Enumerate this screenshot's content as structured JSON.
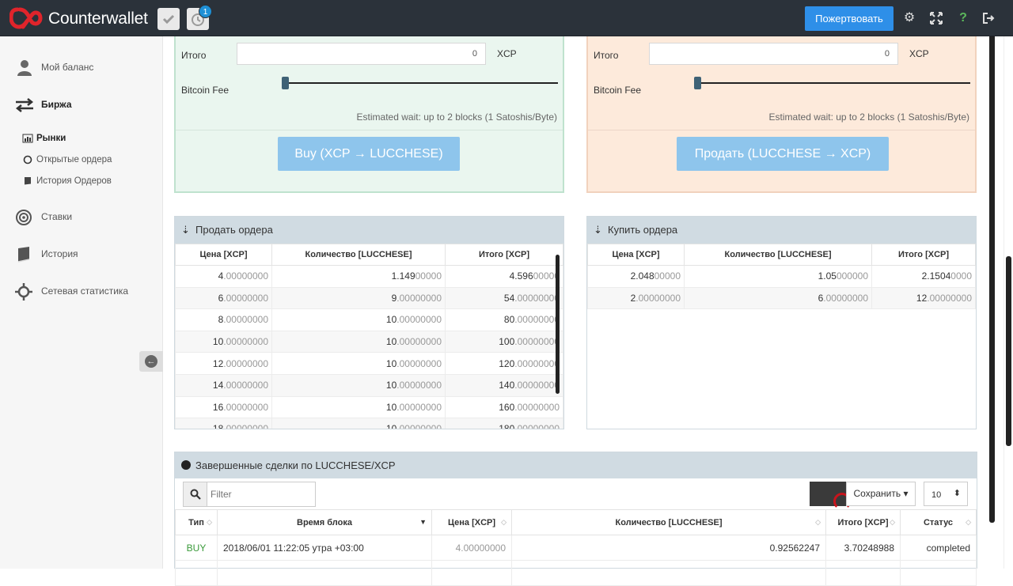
{
  "header": {
    "brand": "Counterwallet",
    "notification_count": "1",
    "donate_label": "Пожертвовать"
  },
  "sidebar": {
    "items": [
      {
        "label": "Мой баланс",
        "icon": "user-icon"
      },
      {
        "label": "Биржа",
        "icon": "exchange-icon"
      },
      {
        "label": "Ставки",
        "icon": "target-icon"
      },
      {
        "label": "История",
        "icon": "book-icon"
      },
      {
        "label": "Сетевая статистика",
        "icon": "crosshair-icon"
      }
    ],
    "subitems": [
      {
        "label": "Рынки",
        "icon": "bar-chart-icon"
      },
      {
        "label": "Открытые ордера",
        "icon": "circle-icon"
      },
      {
        "label": "История Ордеров",
        "icon": "book-icon"
      }
    ]
  },
  "buy_panel": {
    "total_label": "Итого",
    "total_value": "0",
    "unit": "XCP",
    "fee_label": "Bitcoin Fee",
    "estimate": "Estimated wait: up to 2 blocks (1 Satoshis/Byte)",
    "button_label": "Buy (XCP → LUCCHESE)"
  },
  "sell_panel": {
    "total_label": "Итого",
    "total_value": "0",
    "unit": "XCP",
    "fee_label": "Bitcoin Fee",
    "estimate": "Estimated wait: up to 2 blocks (1 Satoshis/Byte)",
    "button_label": "Продать (LUCCHESE → XCP)"
  },
  "sell_orders": {
    "title": "Продать ордера",
    "columns": [
      "Цена [XCP]",
      "Количество [LUCCHESE]",
      "Итого [XCP]"
    ],
    "rows": [
      [
        [
          "4",
          ".00000000"
        ],
        [
          "1.149",
          "00000"
        ],
        [
          "4.596",
          "00000"
        ]
      ],
      [
        [
          "6",
          ".00000000"
        ],
        [
          "9",
          ".00000000"
        ],
        [
          "54",
          ".00000000"
        ]
      ],
      [
        [
          "8",
          ".00000000"
        ],
        [
          "10",
          ".00000000"
        ],
        [
          "80",
          ".00000000"
        ]
      ],
      [
        [
          "10",
          ".00000000"
        ],
        [
          "10",
          ".00000000"
        ],
        [
          "100",
          ".00000000"
        ]
      ],
      [
        [
          "12",
          ".00000000"
        ],
        [
          "10",
          ".00000000"
        ],
        [
          "120",
          ".00000000"
        ]
      ],
      [
        [
          "14",
          ".00000000"
        ],
        [
          "10",
          ".00000000"
        ],
        [
          "140",
          ".00000000"
        ]
      ],
      [
        [
          "16",
          ".00000000"
        ],
        [
          "10",
          ".00000000"
        ],
        [
          "160",
          ".00000000"
        ]
      ],
      [
        [
          "18",
          ".00000000"
        ],
        [
          "10",
          ".00000000"
        ],
        [
          "180",
          ".00000000"
        ]
      ]
    ]
  },
  "buy_orders": {
    "title": "Купить ордера",
    "columns": [
      "Цена [XCP]",
      "Количество [LUCCHESE]",
      "Итого [XCP]"
    ],
    "rows": [
      [
        [
          "2.048",
          "00000"
        ],
        [
          "1.05",
          "000000"
        ],
        [
          "2.1504",
          "0000"
        ]
      ],
      [
        [
          "2",
          ".00000000"
        ],
        [
          "6",
          ".00000000"
        ],
        [
          "12",
          ".00000000"
        ]
      ]
    ]
  },
  "trades": {
    "title": "Завершенные сделки по LUCCHESE/XCP",
    "filter_placeholder": "Filter",
    "save_label": "Сохранить",
    "page_size": "10",
    "columns": [
      "Тип",
      "Время блока",
      "Цена [XCP]",
      "Количество [LUCCHESE]",
      "Итого [XCP]",
      "Статус"
    ],
    "rows": [
      {
        "type": "BUY",
        "time": "2018/06/01 11:22:05 утра +03:00",
        "price_int": "4",
        "price_dec": ".00000000",
        "qty": "0.92562247",
        "total": "3.70248988",
        "status": "completed"
      }
    ]
  },
  "colors": {
    "topbar": "#2b323a",
    "accent": "#2e8fe8",
    "buy_green": "#3a9a3a",
    "brand_red": "#e0242b"
  }
}
